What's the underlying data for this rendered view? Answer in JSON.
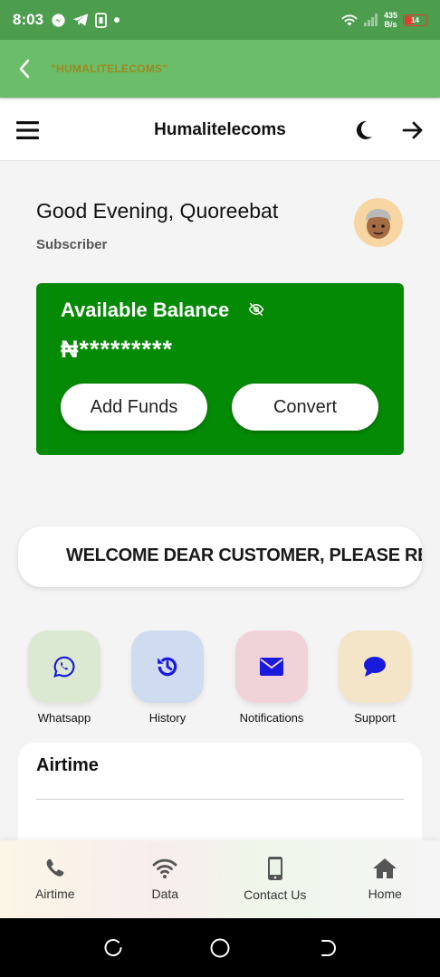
{
  "status_bar": {
    "time": "8:03",
    "netspeed_value": "435",
    "netspeed_unit": "B/s",
    "battery_level": "14",
    "icons": [
      "messenger-icon",
      "telegram-icon",
      "sim-icon",
      "dot-icon",
      "wifi-icon",
      "signal-icon",
      "battery-icon"
    ]
  },
  "webview": {
    "title": "\"HUMALITELECOMS\""
  },
  "header": {
    "title": "Humalitelecoms"
  },
  "user": {
    "greeting": "Good Evening, Quoreebat",
    "role": "Subscriber"
  },
  "balance": {
    "label": "Available Balance",
    "amount": "₦*********",
    "add_funds_label": "Add Funds",
    "convert_label": "Convert"
  },
  "announcement": {
    "text": "WELCOME DEAR CUSTOMER, PLEASE RE"
  },
  "quick_actions": [
    {
      "label": "Whatsapp",
      "icon": "whatsapp-icon",
      "bg": "#dbe9d3"
    },
    {
      "label": "History",
      "icon": "history-icon",
      "bg": "#cfdcef"
    },
    {
      "label": "Notifications",
      "icon": "envelope-icon",
      "bg": "#f0d3d9"
    },
    {
      "label": "Support",
      "icon": "chat-icon",
      "bg": "#f4e4c8"
    }
  ],
  "airtime_section": {
    "title": "Airtime"
  },
  "bottom_nav": [
    {
      "label": "Airtime",
      "icon": "phone-icon"
    },
    {
      "label": "Data",
      "icon": "wifi-icon"
    },
    {
      "label": "Contact Us",
      "icon": "mobile-icon"
    },
    {
      "label": "Home",
      "icon": "home-icon"
    }
  ],
  "colors": {
    "status_bar": "#4d9d4f",
    "webview_bar": "#6cbd6a",
    "balance_card": "#058a05",
    "icon_blue": "#1a1adc"
  }
}
